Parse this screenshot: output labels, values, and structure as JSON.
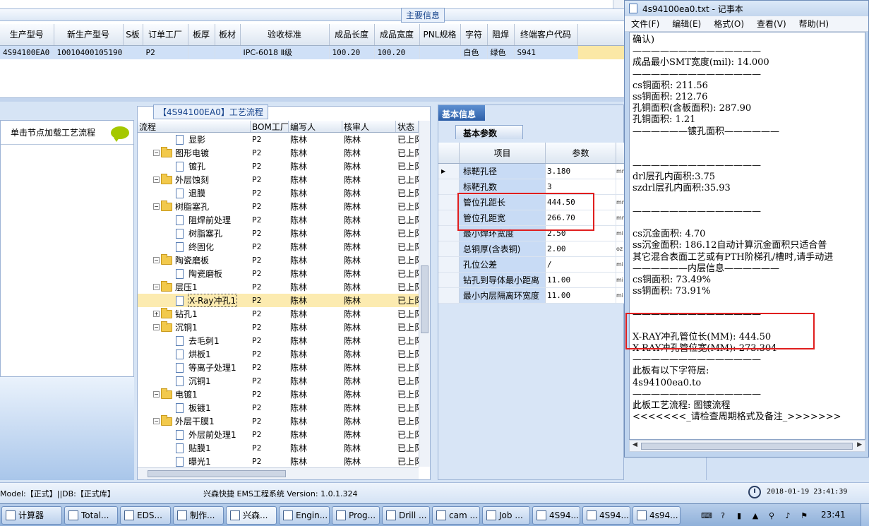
{
  "main_info": {
    "title": "主要信息",
    "columns": [
      "生产型号",
      "新生产型号",
      "S板",
      "订单工厂",
      "板厚",
      "板材",
      "验收标准",
      "成品长度",
      "成品宽度",
      "PNL规格",
      "字符",
      "阻焊",
      "终端客户代码"
    ],
    "row": [
      "4S94100EA0",
      "10010400105190",
      "",
      "P2",
      "",
      "",
      "IPC-6018 Ⅱ级",
      "100.20",
      "100.20",
      "",
      "白色",
      "绿色",
      "S941"
    ]
  },
  "left_pane": {
    "hint": "单击节点加载工艺流程"
  },
  "flow": {
    "title": "【4S94100EA0】工艺流程",
    "columns": [
      "流程",
      "BOM工厂",
      "编写人",
      "核审人",
      "状态"
    ],
    "rows": [
      {
        "name": "显影",
        "type": "doc",
        "level": 1,
        "factory": "P2",
        "author": "陈林",
        "reviewer": "陈林",
        "status": "已上阝"
      },
      {
        "name": "图形电镀",
        "type": "folder",
        "level": 0,
        "expander": "−",
        "factory": "P2",
        "author": "陈林",
        "reviewer": "陈林",
        "status": "已上阝"
      },
      {
        "name": "镀孔",
        "type": "doc",
        "level": 1,
        "factory": "P2",
        "author": "陈林",
        "reviewer": "陈林",
        "status": "已上阝"
      },
      {
        "name": "外层蚀刻",
        "type": "folder",
        "level": 0,
        "expander": "−",
        "factory": "P2",
        "author": "陈林",
        "reviewer": "陈林",
        "status": "已上阝"
      },
      {
        "name": "退膜",
        "type": "doc",
        "level": 1,
        "factory": "P2",
        "author": "陈林",
        "reviewer": "陈林",
        "status": "已上阝"
      },
      {
        "name": "树脂塞孔",
        "type": "folder",
        "level": 0,
        "expander": "−",
        "factory": "P2",
        "author": "陈林",
        "reviewer": "陈林",
        "status": "已上阝"
      },
      {
        "name": "阻焊前处理",
        "type": "doc",
        "level": 1,
        "factory": "P2",
        "author": "陈林",
        "reviewer": "陈林",
        "status": "已上阝"
      },
      {
        "name": "树脂塞孔",
        "type": "doc",
        "level": 1,
        "factory": "P2",
        "author": "陈林",
        "reviewer": "陈林",
        "status": "已上阝"
      },
      {
        "name": "终固化",
        "type": "doc",
        "level": 1,
        "factory": "P2",
        "author": "陈林",
        "reviewer": "陈林",
        "status": "已上阝"
      },
      {
        "name": "陶瓷磨板",
        "type": "folder",
        "level": 0,
        "expander": "−",
        "factory": "P2",
        "author": "陈林",
        "reviewer": "陈林",
        "status": "已上阝"
      },
      {
        "name": "陶瓷磨板",
        "type": "doc",
        "level": 1,
        "factory": "P2",
        "author": "陈林",
        "reviewer": "陈林",
        "status": "已上阝"
      },
      {
        "name": "层压1",
        "type": "folder",
        "level": 0,
        "expander": "−",
        "factory": "P2",
        "author": "陈林",
        "reviewer": "陈林",
        "status": "已上阝"
      },
      {
        "name": "X-Ray冲孔1",
        "type": "doc",
        "level": 1,
        "selected": true,
        "factory": "P2",
        "author": "陈林",
        "reviewer": "陈林",
        "status": "已上阝"
      },
      {
        "name": "钻孔1",
        "type": "folder",
        "level": 0,
        "expander": "+",
        "factory": "P2",
        "author": "陈林",
        "reviewer": "陈林",
        "status": "已上阝"
      },
      {
        "name": "沉铜1",
        "type": "folder",
        "level": 0,
        "expander": "−",
        "factory": "P2",
        "author": "陈林",
        "reviewer": "陈林",
        "status": "已上阝"
      },
      {
        "name": "去毛刺1",
        "type": "doc",
        "level": 1,
        "factory": "P2",
        "author": "陈林",
        "reviewer": "陈林",
        "status": "已上阝"
      },
      {
        "name": "烘板1",
        "type": "doc",
        "level": 1,
        "factory": "P2",
        "author": "陈林",
        "reviewer": "陈林",
        "status": "已上阝"
      },
      {
        "name": "等离子处理1",
        "type": "doc",
        "level": 1,
        "factory": "P2",
        "author": "陈林",
        "reviewer": "陈林",
        "status": "已上阝"
      },
      {
        "name": "沉铜1",
        "type": "doc",
        "level": 1,
        "factory": "P2",
        "author": "陈林",
        "reviewer": "陈林",
        "status": "已上阝"
      },
      {
        "name": "电镀1",
        "type": "folder",
        "level": 0,
        "expander": "−",
        "factory": "P2",
        "author": "陈林",
        "reviewer": "陈林",
        "status": "已上阝"
      },
      {
        "name": "板镀1",
        "type": "doc",
        "level": 1,
        "factory": "P2",
        "author": "陈林",
        "reviewer": "陈林",
        "status": "已上阝"
      },
      {
        "name": "外层干膜1",
        "type": "folder",
        "level": 0,
        "expander": "−",
        "factory": "P2",
        "author": "陈林",
        "reviewer": "陈林",
        "status": "已上阝"
      },
      {
        "name": "外层前处理1",
        "type": "doc",
        "level": 1,
        "factory": "P2",
        "author": "陈林",
        "reviewer": "陈林",
        "status": "已上阝"
      },
      {
        "name": "贴膜1",
        "type": "doc",
        "level": 1,
        "factory": "P2",
        "author": "陈林",
        "reviewer": "陈林",
        "status": "已上阝"
      },
      {
        "name": "曝光1",
        "type": "doc",
        "level": 1,
        "factory": "P2",
        "author": "陈林",
        "reviewer": "陈林",
        "status": "已上阝"
      }
    ]
  },
  "basic": {
    "tab": "基本信息",
    "subtab": "基本参数",
    "col_item": "项目",
    "col_param": "参数",
    "rows": [
      {
        "name": "标靶孔径",
        "value": "3.180",
        "unit": "mm",
        "current": true
      },
      {
        "name": "标靶孔数",
        "value": "3",
        "unit": ""
      },
      {
        "name": "管位孔距长",
        "value": "444.50",
        "unit": "mm"
      },
      {
        "name": "管位孔距宽",
        "value": "266.70",
        "unit": "mm"
      },
      {
        "name": "最小焊环宽度",
        "value": "2.50",
        "unit": "mi"
      },
      {
        "name": "总铜厚(含表铜)",
        "value": "2.00",
        "unit": "oz"
      },
      {
        "name": "孔位公差",
        "value": "/",
        "unit": "mi"
      },
      {
        "name": "钻孔到导体最小距离",
        "value": "11.00",
        "unit": "mi"
      },
      {
        "name": "最小内层隔离环宽度",
        "value": "11.00",
        "unit": "mi"
      }
    ]
  },
  "notepad": {
    "title": "4s94100ea0.txt - 记事本",
    "menu": [
      "文件(F)",
      "编辑(E)",
      "格式(O)",
      "查看(V)",
      "帮助(H)"
    ],
    "lines": [
      "确认)",
      "——————————————",
      "成品最小SMT宽度(mil): 14.000",
      "——————————————",
      "cs铜面积: 211.56",
      "ss铜面积: 212.76",
      "孔铜面积(含板面积): 287.90",
      "孔铜面积: 1.21",
      "——————镀孔面积——————",
      "",
      "",
      "——————————————",
      "drl层孔内面积:3.75",
      "szdrl层孔内面积:35.93",
      "",
      "——————————————",
      "",
      "cs沉金面积: 4.70",
      "ss沉金面积: 186.12自动计算沉金面积只适合普",
      "其它混合表面工艺或有PTH阶梯孔/槽时,请手动进",
      "——————内层信息——————",
      "cs铜面积: 73.49%",
      "ss铜面积: 73.91%",
      "",
      "——————————————",
      "",
      "X-RAY冲孔管位长(MM): 444.50",
      "X-RAY冲孔管位宽(MM): 273.304",
      "——————————————",
      "此板有以下字符层:",
      "4s94100ea0.to",
      "——————————————",
      "此板工艺流程: 图镀流程",
      "<<<<<<<_请检查周期格式及备注_>>>>>>>"
    ]
  },
  "status": {
    "left": "Model:【正式】||DB:【正式库】",
    "middle": "兴森快捷 EMS工程系统 Version: 1.0.1.324",
    "datetime": "2018-01-19 23:41:39"
  },
  "taskbar": {
    "items": [
      {
        "label": "计算器",
        "name": "calculator"
      },
      {
        "label": "Total...",
        "name": "total"
      },
      {
        "label": "EDS...",
        "name": "eds"
      },
      {
        "label": "制作...",
        "name": "make"
      },
      {
        "label": "兴森...",
        "name": "xingsen",
        "active": true
      },
      {
        "label": "Engin...",
        "name": "engin"
      },
      {
        "label": "Prog...",
        "name": "prog"
      },
      {
        "label": "Drill ...",
        "name": "drill"
      },
      {
        "label": "cam ...",
        "name": "cam"
      },
      {
        "label": "Job ...",
        "name": "job"
      },
      {
        "label": "4S94...",
        "name": "4s94-a"
      },
      {
        "label": "4S94...",
        "name": "4s94-b"
      },
      {
        "label": "4s94...",
        "name": "4s94-c"
      }
    ],
    "time": "23:41"
  }
}
